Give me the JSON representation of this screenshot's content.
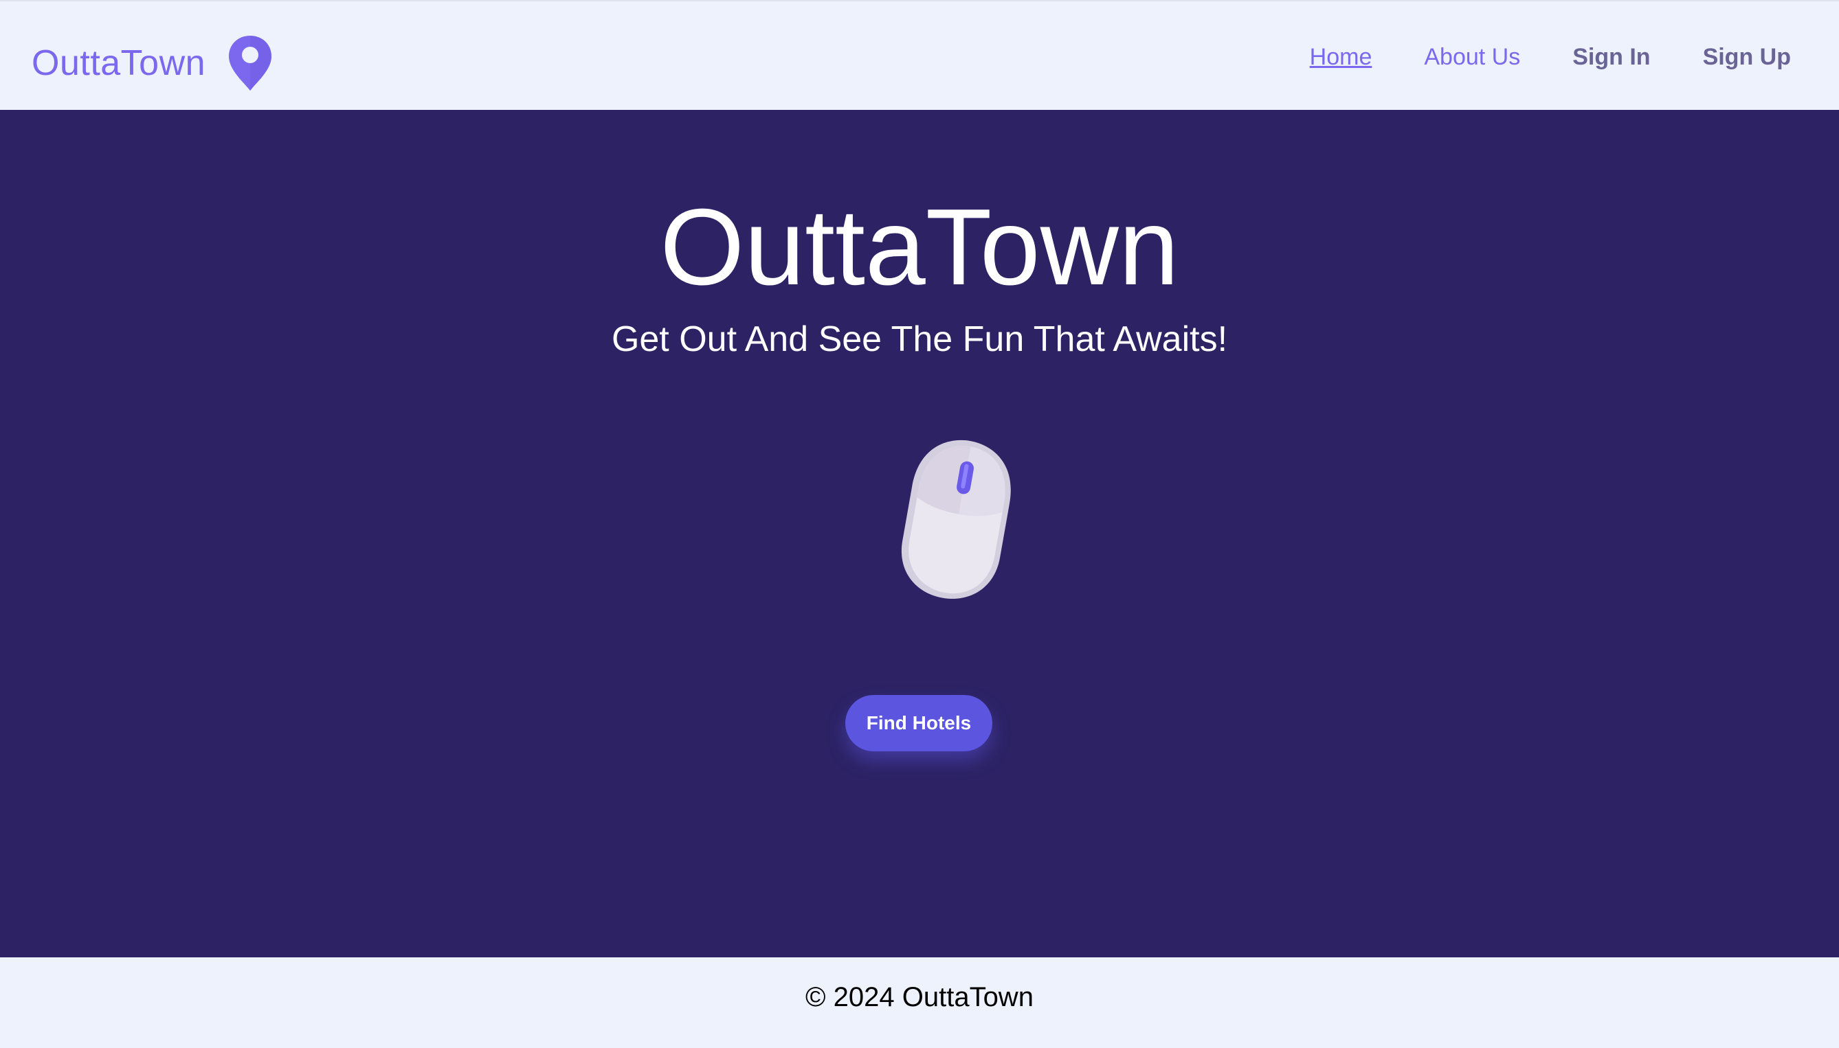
{
  "brand": {
    "name": "OuttaTown",
    "icon": "map-pin-icon",
    "color": "#7b68ee"
  },
  "nav": {
    "home": "Home",
    "about": "About Us",
    "sign_in": "Sign In",
    "sign_up": "Sign Up"
  },
  "hero": {
    "title": "OuttaTown",
    "subtitle": "Get Out And See The Fun That Awaits!",
    "illustration": "computer-mouse-icon",
    "button_label": "Find Hotels",
    "background": "#2c2264",
    "accent": "#5b55e0"
  },
  "footer": {
    "copyright": "© 2024 OuttaTown"
  }
}
